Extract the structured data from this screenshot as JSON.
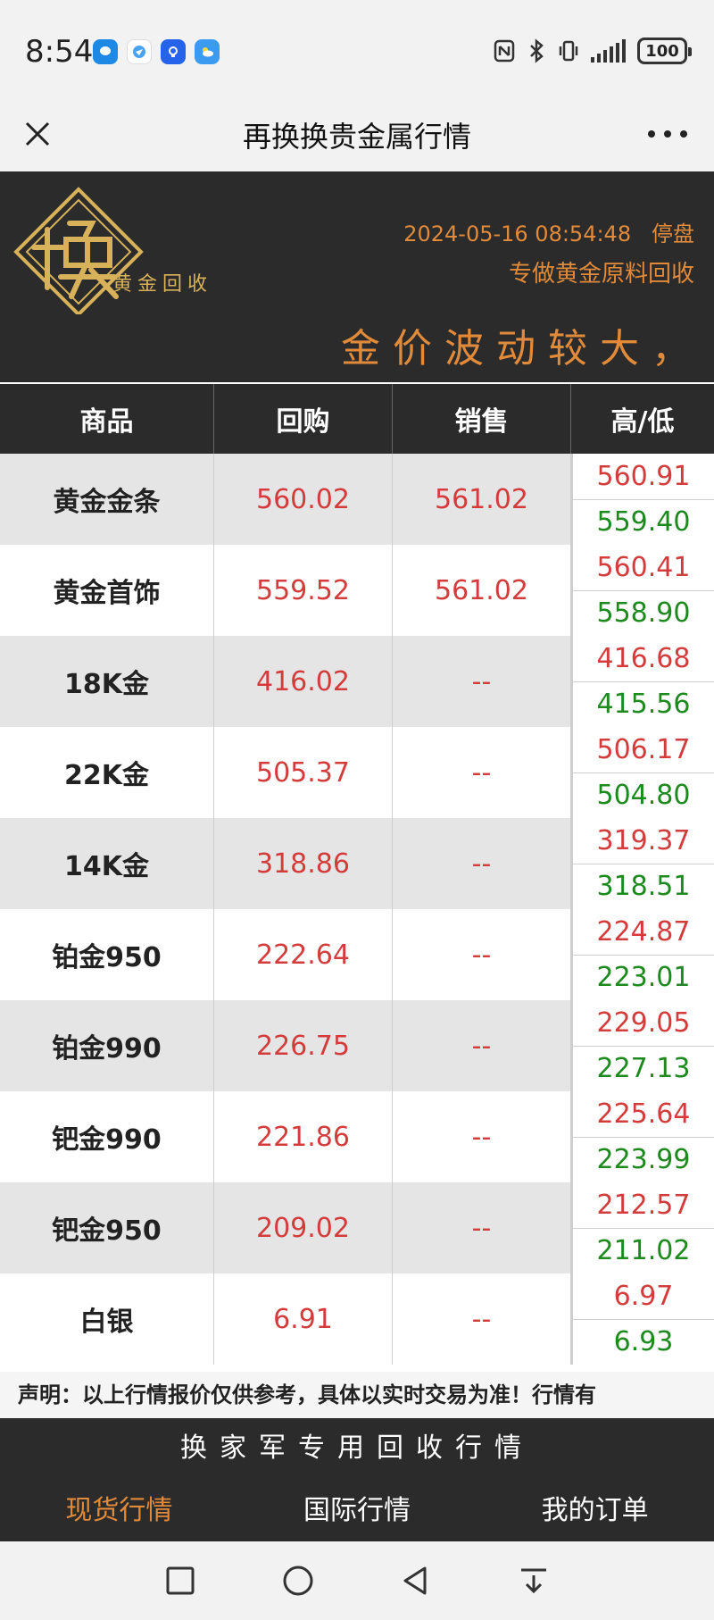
{
  "status_bar": {
    "time": "8:54",
    "battery": "100"
  },
  "titlebar": {
    "title": "再换换贵金属行情"
  },
  "header": {
    "logo_caption": "黄金回收",
    "datetime": "2024-05-16 08:54:48",
    "market_status": "停盘",
    "slogan": "专做黄金原料回收",
    "marquee": "金价波动较大，"
  },
  "table": {
    "headers": [
      "商品",
      "回购",
      "销售",
      "高/低"
    ],
    "rows": [
      {
        "name": "黄金金条",
        "buy": "560.02",
        "sell": "561.02",
        "high": "560.91",
        "low": "559.40"
      },
      {
        "name": "黄金首饰",
        "buy": "559.52",
        "sell": "561.02",
        "high": "560.41",
        "low": "558.90"
      },
      {
        "name": "18K金",
        "buy": "416.02",
        "sell": "--",
        "high": "416.68",
        "low": "415.56"
      },
      {
        "name": "22K金",
        "buy": "505.37",
        "sell": "--",
        "high": "506.17",
        "low": "504.80"
      },
      {
        "name": "14K金",
        "buy": "318.86",
        "sell": "--",
        "high": "319.37",
        "low": "318.51"
      },
      {
        "name": "铂金950",
        "buy": "222.64",
        "sell": "--",
        "high": "224.87",
        "low": "223.01"
      },
      {
        "name": "铂金990",
        "buy": "226.75",
        "sell": "--",
        "high": "229.05",
        "low": "227.13"
      },
      {
        "name": "钯金990",
        "buy": "221.86",
        "sell": "--",
        "high": "225.64",
        "low": "223.99"
      },
      {
        "name": "钯金950",
        "buy": "209.02",
        "sell": "--",
        "high": "212.57",
        "low": "211.02"
      },
      {
        "name": "白银",
        "buy": "6.91",
        "sell": "--",
        "high": "6.97",
        "low": "6.93"
      }
    ]
  },
  "disclaimer": "声明：以上行情报价仅供参考，具体以实时交易为准！行情有",
  "footer": {
    "title": "换家军专用回收行情",
    "tabs": [
      "现货行情",
      "国际行情",
      "我的订单"
    ],
    "active_tab": 0
  },
  "colors": {
    "accent": "#e08a3a",
    "price_red": "#d43c3c",
    "low_green": "#1c8a1c",
    "dark_bg": "#2b2b2b",
    "logo_gold": "#d8b25a"
  }
}
